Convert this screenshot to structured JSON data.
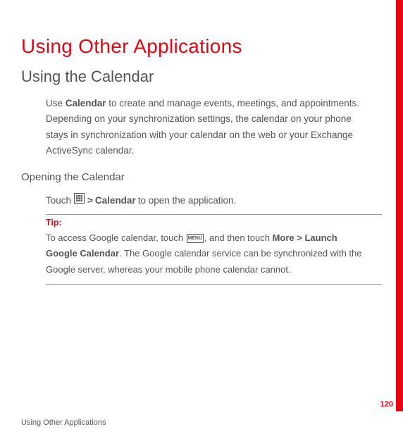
{
  "heading1": "Using Other Applications",
  "heading2": "Using the Calendar",
  "intro": {
    "pre": "Use ",
    "bold1": "Calendar",
    "post": " to create and manage events, meetings, and appointments. Depending on your synchronization settings, the calendar on your phone stays in synchronization with your calendar on the web or your Exchange ActiveSync calendar."
  },
  "heading3": "Opening the Calendar",
  "openLine": {
    "touch": "Touch",
    "gt": ">",
    "bold": "Calendar",
    "rest": "to open the application."
  },
  "tip": {
    "label": "Tip:",
    "seg1": "To access Google calendar,  touch ",
    "menuLabel": "MENU",
    "seg2": ", and then touch ",
    "bold1": "More > Launch Google Calendar",
    "seg3": ". The Google calendar service can be synchronized with the Google server, whereas your mobile phone calendar cannot."
  },
  "footer": "Using Other Applications",
  "pageNumber": "120"
}
